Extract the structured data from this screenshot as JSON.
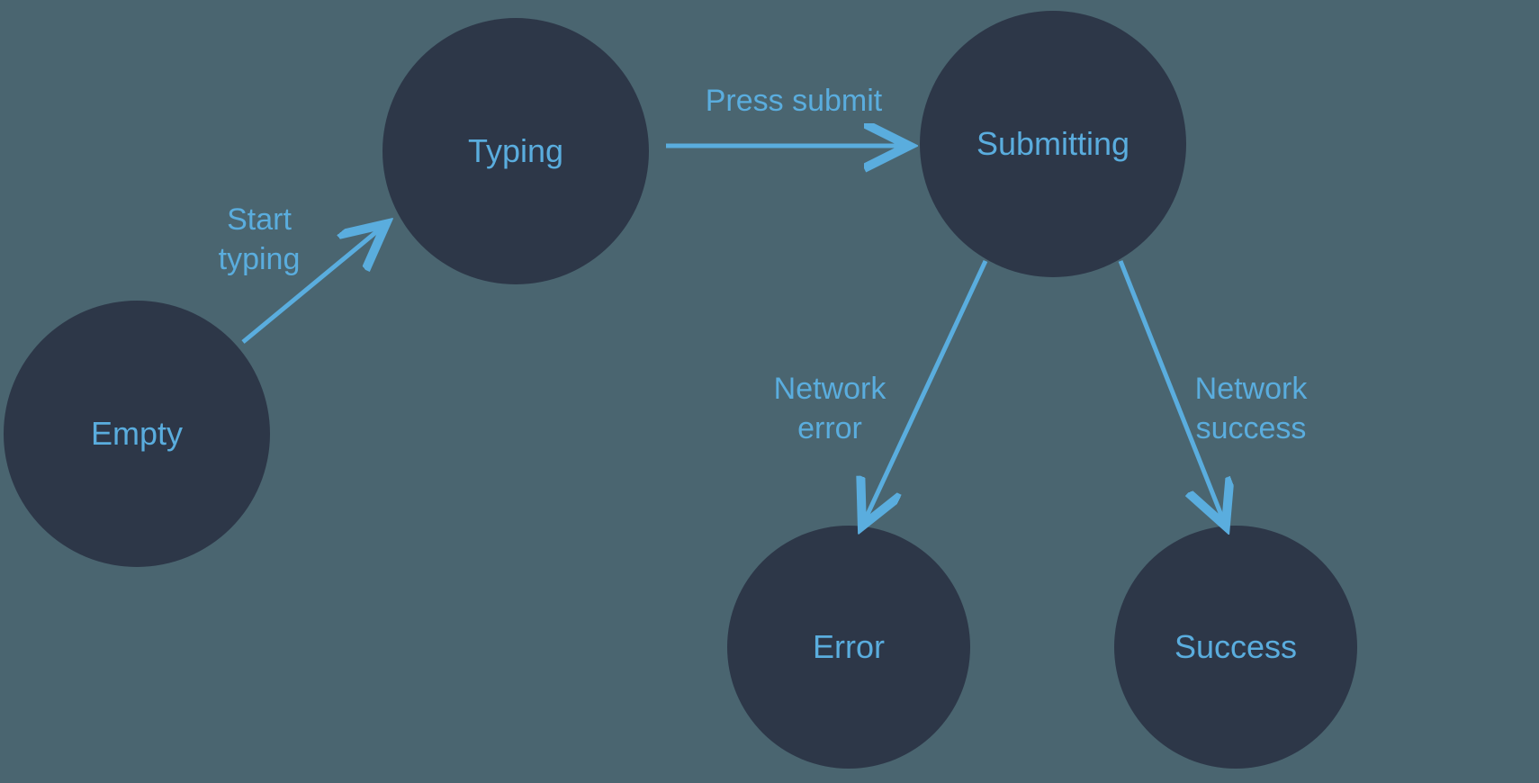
{
  "states": {
    "empty": "Empty",
    "typing": "Typing",
    "submitting": "Submitting",
    "error": "Error",
    "success": "Success"
  },
  "transitions": {
    "startTyping": "Start\ntyping",
    "pressSubmit": "Press submit",
    "networkError": "Network\nerror",
    "networkSuccess": "Network\nsuccess"
  },
  "colors": {
    "background": "#4a6570",
    "nodeFill": "#2d3748",
    "accent": "#5aadde"
  }
}
